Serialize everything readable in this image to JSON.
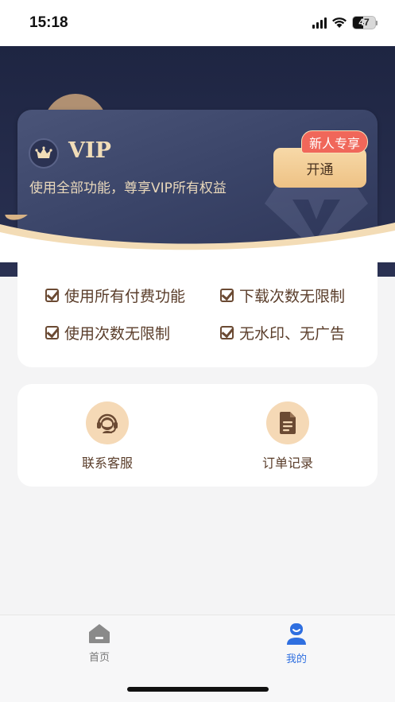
{
  "status_bar": {
    "time": "15:18",
    "battery": "47"
  },
  "vip_card": {
    "title": "VIP",
    "subtitle": "使用全部功能，尊享VIP所有权益",
    "open_button": "开通",
    "badge": "新人专享"
  },
  "benefits": [
    "使用所有付费功能",
    "下载次数无限制",
    "使用次数无限制",
    "无水印、无广告"
  ],
  "services": [
    {
      "label": "联系客服",
      "icon": "headset-icon"
    },
    {
      "label": "订单记录",
      "icon": "document-icon"
    }
  ],
  "tabbar": [
    {
      "label": "首页",
      "icon": "home-icon",
      "active": false
    },
    {
      "label": "我的",
      "icon": "user-icon",
      "active": true
    }
  ],
  "colors": {
    "hero_dark": "#1e2542",
    "gold": "#f1ddb8",
    "accent_red": "#f0675a",
    "active_tab": "#2f6fe0",
    "inactive_tab": "#777777"
  }
}
